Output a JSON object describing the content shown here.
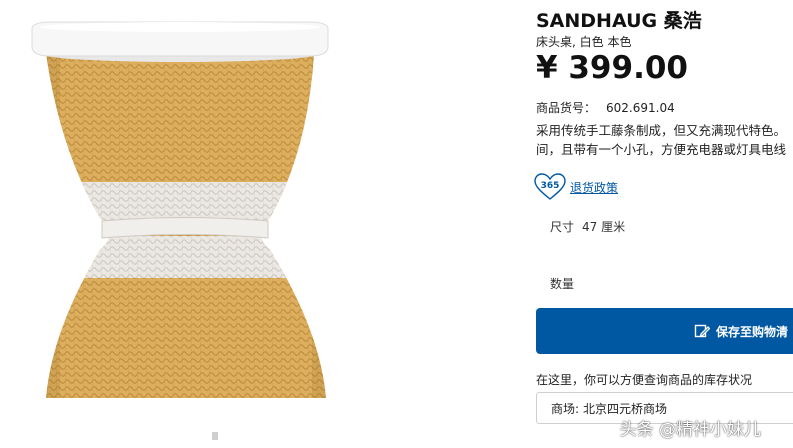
{
  "product": {
    "name": "SANDHAUG 桑浩",
    "subtitle": "床头桌, 白色 本色",
    "price": "¥ 399.00",
    "article_label": "商品货号：",
    "article_number": "602.691.04",
    "description_line1": "采用传统手工藤条制成，但又充满现代特色。",
    "description_line2": "间，且带有一个小孔，方便充电器或灯具电线"
  },
  "return_policy": {
    "badge": "365",
    "label": "退货政策"
  },
  "size": {
    "label": "尺寸",
    "value": "47 厘米"
  },
  "quantity": {
    "label": "数量"
  },
  "save_button": {
    "label": "保存至购物清"
  },
  "stock": {
    "hint": "在这里，你可以方便查询商品的库存状况",
    "store_label": "商场:",
    "store_value": "北京四元桥商场"
  },
  "watermark": "头条 @精神小妹儿",
  "colors": {
    "accent": "#0058a3",
    "rattan": "#d9a955",
    "white_band": "#e9e6e1"
  }
}
